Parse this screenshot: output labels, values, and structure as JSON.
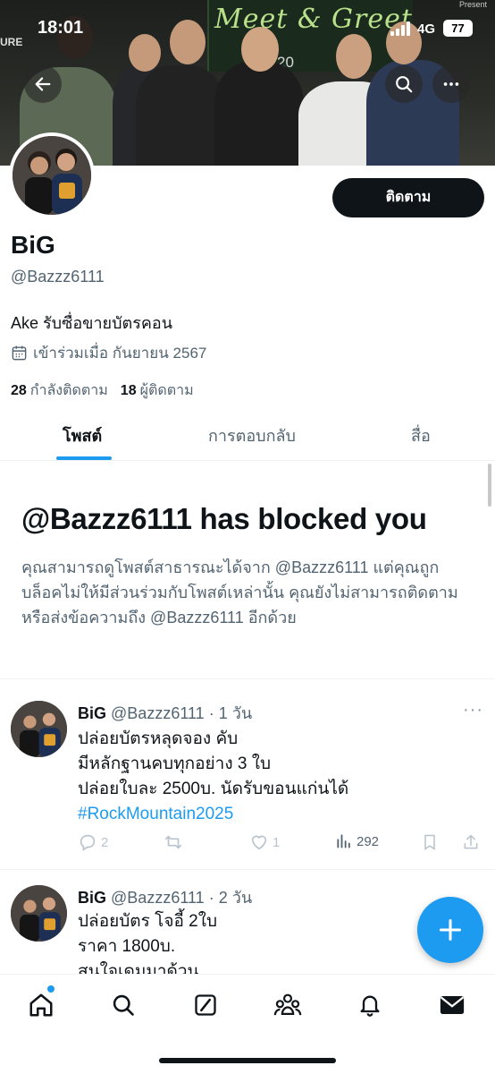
{
  "status_bar": {
    "time": "18:01",
    "network": "4G",
    "battery": "77"
  },
  "banner": {
    "sign_title": "Meet & Greet",
    "sign_sub": "Feb 20",
    "corner_text": "URE",
    "present_text": "Present"
  },
  "profile": {
    "name": "BiG",
    "handle": "@Bazzz6111",
    "bio": "Ake รับซื่อขายบัตรคอน",
    "joined": "เข้าร่วมเมื่อ กันยายน 2567",
    "following_count": "28",
    "following_label": "กำลังติดตาม",
    "followers_count": "18",
    "followers_label": "ผู้ติดตาม",
    "follow_button": "ติดตาม"
  },
  "tabs": [
    {
      "label": "โพสต์",
      "active": true
    },
    {
      "label": "การตอบกลับ",
      "active": false
    },
    {
      "label": "สื่อ",
      "active": false
    }
  ],
  "blocked": {
    "title": "@Bazzz6111 has blocked you",
    "text": "คุณสามารถดูโพสต์สาธารณะได้จาก @Bazzz6111 แต่คุณถูกบล็อคไม่ให้มีส่วนร่วมกับโพสต์เหล่านั้น คุณยังไม่สามารถติดตามหรือส่งข้อความถึง @Bazzz6111 อีกด้วย"
  },
  "tweets": [
    {
      "name": "BiG",
      "handle": "@Bazzz6111",
      "time": "· 1 วัน",
      "lines": [
        "ปล่อยบัตรหลุดจอง คับ",
        "มีหลักฐานคบทุกอย่าง 3 ใบ",
        "ปล่อยใบละ 2500บ. นัดรับขอนแก่นได้"
      ],
      "hashtag": "#RockMountain2025",
      "replies": "2",
      "retweets": "",
      "likes": "1",
      "views": "292"
    },
    {
      "name": "BiG",
      "handle": "@Bazzz6111",
      "time": "· 2 วัน",
      "lines": [
        "ปล่อยบัตร โจอี้ 2ใบ",
        "ราคา 1800บ.",
        "สนใจเดมมาด้วน"
      ]
    }
  ],
  "colors": {
    "accent": "#1d9bf0",
    "text": "#0f1419",
    "muted": "#536471"
  },
  "icons": [
    "back-arrow-icon",
    "search-icon",
    "more-icon",
    "calendar-icon",
    "reply-icon",
    "retweet-icon",
    "like-icon",
    "views-icon",
    "bookmark-icon",
    "share-icon",
    "plus-icon",
    "home-icon",
    "explore-icon",
    "grok-icon",
    "communities-icon",
    "notifications-icon",
    "messages-icon"
  ]
}
